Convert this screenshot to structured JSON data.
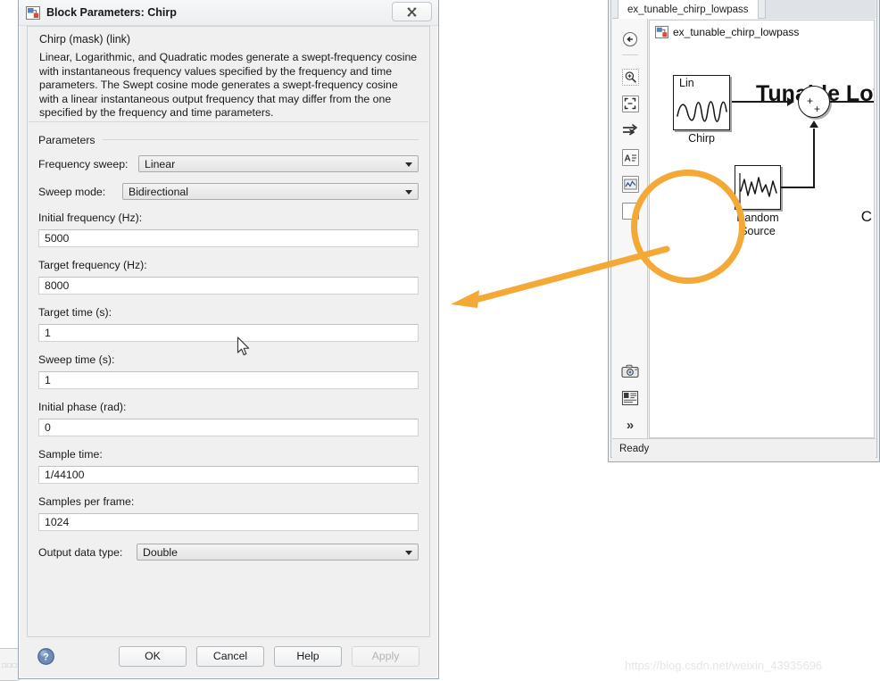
{
  "dialog": {
    "title": "Block Parameters: Chirp",
    "title_icon": "simulink-block-icon",
    "close_label": "✖",
    "description": {
      "heading": "Chirp (mask) (link)",
      "text": "Linear, Logarithmic, and Quadratic modes generate a swept-frequency cosine with instantaneous frequency values specified by the frequency and time parameters.   The Swept cosine mode generates a swept-frequency cosine with a linear instantaneous output frequency that may differ from the one specified by the frequency and time parameters."
    },
    "parameters_legend": "Parameters",
    "fields": [
      {
        "label": "Frequency sweep:",
        "value": "Linear",
        "type": "select",
        "layout": "inline"
      },
      {
        "label": "Sweep mode:",
        "value": "Bidirectional",
        "type": "select",
        "layout": "inline"
      },
      {
        "label": "Initial frequency (Hz):",
        "value": "5000",
        "type": "text",
        "layout": "stacked"
      },
      {
        "label": "Target frequency (Hz):",
        "value": "8000",
        "type": "text",
        "layout": "stacked"
      },
      {
        "label": "Target time (s):",
        "value": "1",
        "type": "text",
        "layout": "stacked"
      },
      {
        "label": "Sweep time (s):",
        "value": "1",
        "type": "text",
        "layout": "stacked"
      },
      {
        "label": "Initial phase (rad):",
        "value": "0",
        "type": "text",
        "layout": "stacked"
      },
      {
        "label": "Sample time:",
        "value": "1/44100",
        "type": "text",
        "layout": "stacked"
      },
      {
        "label": "Samples per frame:",
        "value": "1024",
        "type": "text",
        "layout": "stacked"
      },
      {
        "label": "Output data type:",
        "value": "Double",
        "type": "select",
        "layout": "inline"
      }
    ],
    "footer": {
      "help_icon": "help-question-icon",
      "ok_label": "OK",
      "cancel_label": "Cancel",
      "help_label": "Help",
      "apply_label": "Apply",
      "apply_disabled": true
    }
  },
  "model_window": {
    "tab_label": "ex_tunable_chirp_lowpass",
    "breadcrumb_label": "ex_tunable_chirp_lowpass",
    "breadcrumb_icon": "simulink-model-icon",
    "canvas_title": "Tunable Low",
    "canvas_right_letter": "C",
    "status_text": "Ready",
    "toolbar_items": [
      {
        "name": "navigate-back-icon",
        "glyph": "←"
      },
      {
        "name": "zoom-in-icon",
        "glyph": "⊕"
      },
      {
        "name": "fit-to-view-icon",
        "glyph": "⛶"
      },
      {
        "name": "signal-routing-icon",
        "glyph": "⇉"
      },
      {
        "name": "annotation-text-icon",
        "glyph": "A"
      },
      {
        "name": "scope-image-icon",
        "glyph": "∿"
      },
      {
        "name": "rectangle-icon",
        "glyph": ""
      },
      {
        "name": "camera-snapshot-icon",
        "glyph": "▣"
      },
      {
        "name": "model-legend-icon",
        "glyph": "▤"
      },
      {
        "name": "more-chevron-icon",
        "glyph": "»"
      }
    ],
    "blocks": [
      {
        "name": "chirp-block",
        "caption": "Chirp",
        "inner_label": "Lin"
      },
      {
        "name": "random-source-block",
        "caption": "Random\nSource",
        "inner_label": ""
      },
      {
        "name": "sum-block",
        "caption": "",
        "inner_label": "+ +"
      }
    ]
  },
  "annotation": {
    "circle_name": "highlight-circle",
    "arrow_name": "callout-arrow",
    "color": "#F4A836"
  },
  "watermark": {
    "text": "https://blog.csdn.net/weixin_43935696"
  }
}
